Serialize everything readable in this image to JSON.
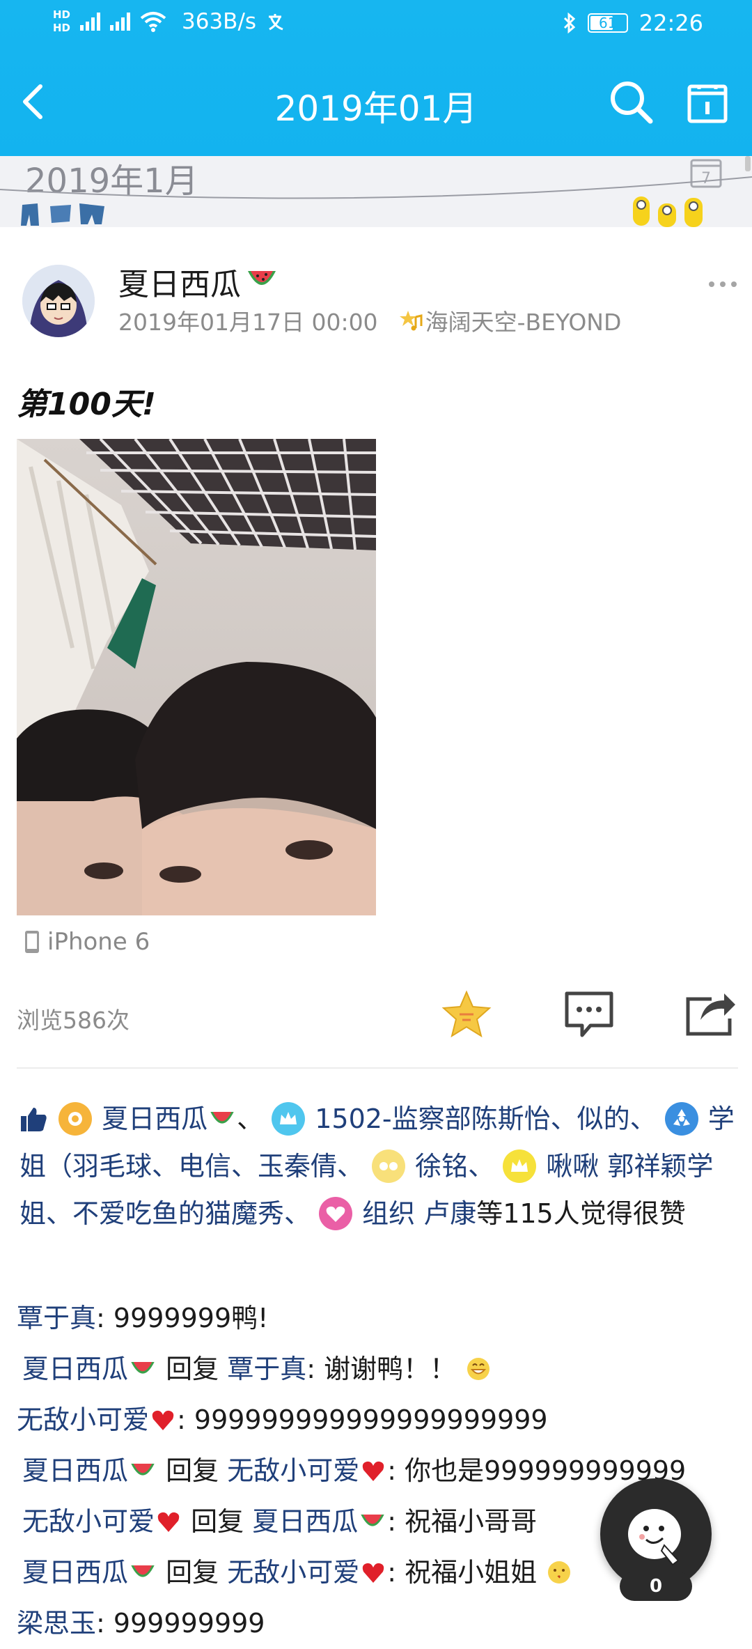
{
  "status_bar": {
    "hd1": "HD",
    "hd2": "HD",
    "net1": "4G",
    "net2": "4G",
    "speed": "363B/s",
    "battery": "61",
    "time": "22:26"
  },
  "nav": {
    "title": "2019年01月"
  },
  "banner": {
    "month": "2019年1月",
    "cal_day": "7"
  },
  "post": {
    "author": "夏日西瓜",
    "date": "2019年01月17日 00:00",
    "music": "海阔天空-BEYOND",
    "text": "第100天!",
    "device": "iPhone 6",
    "views": "浏览586次"
  },
  "likes": {
    "names": [
      "夏日西瓜",
      "、",
      "1502-监察部陈斯怡、似的、",
      "学姐（羽毛球、电信、玉秦倩、",
      "徐铭、",
      "啾啾",
      "郭祥颖学姐、不爱吃鱼的猫魔秀、",
      "组织 卢康"
    ],
    "suffix": "等115人觉得很赞"
  },
  "comments": [
    {
      "name": "覃于真",
      "reply_to": "",
      "text": ": 9999999鸭!"
    },
    {
      "name": "夏日西瓜",
      "reply_word": "回复",
      "reply_to": "覃于真",
      "text": ": 谢谢鸭！！"
    },
    {
      "name": "无敌小可爱",
      "reply_to": "",
      "text": ": 999999999999999999999"
    },
    {
      "name": "夏日西瓜",
      "reply_word": "回复",
      "reply_to": "无敌小可爱",
      "text": ": 你也是999999999999"
    },
    {
      "name": "无敌小可爱",
      "reply_word": "回复",
      "reply_to": "夏日西瓜",
      "text": ": 祝福小哥哥"
    },
    {
      "name": "夏日西瓜",
      "reply_word": "回复",
      "reply_to": "无敌小可爱",
      "text": ": 祝福小姐姐"
    },
    {
      "name": "梁思玉",
      "reply_to": "",
      "text": ": 999999999"
    }
  ],
  "float": {
    "count": "0"
  },
  "colors": {
    "accent": "#13b3ef",
    "name_link": "#1f3f7a",
    "muted": "#8b8b8b"
  }
}
